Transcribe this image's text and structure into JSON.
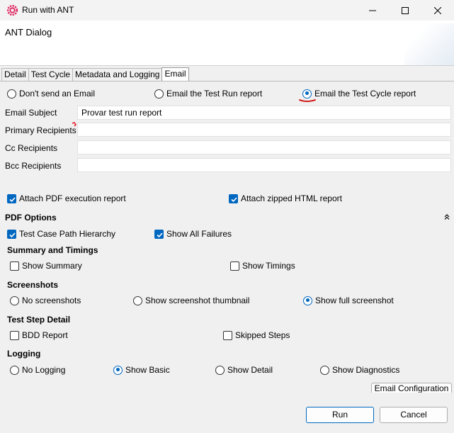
{
  "window": {
    "title": "Run with ANT"
  },
  "header": {
    "title": "ANT Dialog"
  },
  "tabs": [
    {
      "label": "Detail",
      "active": false
    },
    {
      "label": "Test Cycle",
      "active": false
    },
    {
      "label": "Metadata and Logging",
      "active": false
    },
    {
      "label": "Email",
      "active": true
    }
  ],
  "email_mode": {
    "options": [
      {
        "label": "Don't send an Email",
        "selected": false
      },
      {
        "label": "Email the Test Run report",
        "selected": false
      },
      {
        "label": "Email the Test Cycle report",
        "selected": true
      }
    ]
  },
  "fields": {
    "subject": {
      "label": "Email Subject",
      "value": "Provar test run report"
    },
    "primary": {
      "label": "Primary Recipients",
      "value": ""
    },
    "cc": {
      "label": "Cc Recipients",
      "value": ""
    },
    "bcc": {
      "label": "Bcc Recipients",
      "value": ""
    }
  },
  "attachments": {
    "pdf": {
      "label": "Attach PDF execution report",
      "checked": true
    },
    "html": {
      "label": "Attach zipped HTML report",
      "checked": true
    }
  },
  "pdf_options": {
    "title": "PDF Options",
    "collapse_icon": "double-chevron-up-icon",
    "hierarchy": {
      "label": "Test Case Path Hierarchy",
      "checked": true
    },
    "failures": {
      "label": "Show All Failures",
      "checked": true
    }
  },
  "summary": {
    "title": "Summary and Timings",
    "show_summary": {
      "label": "Show Summary",
      "checked": false
    },
    "show_timings": {
      "label": "Show Timings",
      "checked": false
    }
  },
  "screenshots": {
    "title": "Screenshots",
    "options": [
      {
        "label": "No screenshots",
        "selected": false
      },
      {
        "label": "Show screenshot thumbnail",
        "selected": false
      },
      {
        "label": "Show full screenshot",
        "selected": true
      }
    ]
  },
  "test_step": {
    "title": "Test Step Detail",
    "bdd": {
      "label": "BDD Report",
      "checked": false
    },
    "skipped": {
      "label": "Skipped Steps",
      "checked": false
    }
  },
  "logging": {
    "title": "Logging",
    "options": [
      {
        "label": "No Logging",
        "selected": false
      },
      {
        "label": "Show Basic",
        "selected": true
      },
      {
        "label": "Show Detail",
        "selected": false
      },
      {
        "label": "Show Diagnostics",
        "selected": false
      }
    ]
  },
  "buttons": {
    "email_config": "Email Configuration",
    "run": "Run",
    "cancel": "Cancel"
  },
  "colors": {
    "accent": "#0067c0",
    "required_marker": "#e81123",
    "annotation": "#d00000"
  }
}
